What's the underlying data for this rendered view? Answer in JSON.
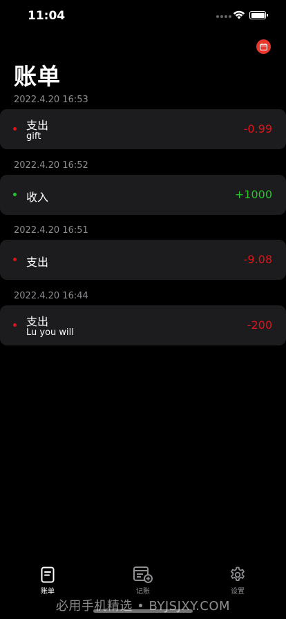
{
  "status_bar": {
    "time": "11:04"
  },
  "header": {
    "title": "账单"
  },
  "colors": {
    "expense": "#e0141a",
    "income": "#25c52b",
    "accent": "#e8362b",
    "card_bg": "#1c1c1e"
  },
  "bills": [
    {
      "date": "2022.4.20 16:53",
      "type": "支出",
      "note": "gift",
      "amount": "-0.99",
      "kind": "expense"
    },
    {
      "date": "2022.4.20 16:52",
      "type": "收入",
      "note": "",
      "amount": "+1000",
      "kind": "income"
    },
    {
      "date": "2022.4.20 16:51",
      "type": "支出",
      "note": "",
      "amount": "-9.08",
      "kind": "expense"
    },
    {
      "date": "2022.4.20 16:44",
      "type": "支出",
      "note": "Lu you will",
      "amount": "-200",
      "kind": "expense"
    }
  ],
  "tab_bar": {
    "tabs": [
      {
        "label": "账单",
        "icon": "bill-icon",
        "active": true
      },
      {
        "label": "记账",
        "icon": "add-record-icon",
        "active": false
      },
      {
        "label": "设置",
        "icon": "gear-icon",
        "active": false
      }
    ]
  },
  "watermark": "必用手机精选 • BYJSJXY.COM"
}
